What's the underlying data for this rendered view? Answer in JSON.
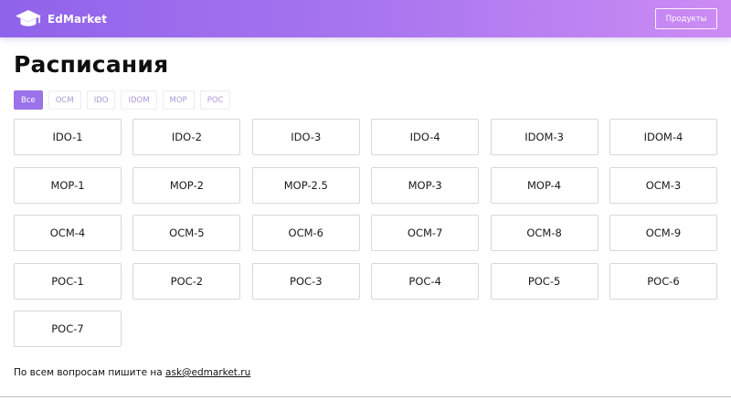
{
  "header": {
    "logo_text": "EdMarket",
    "products_button": "Продукты",
    "logo_icon": "graduation-cap-icon"
  },
  "main": {
    "title": "Расписания",
    "filters": [
      {
        "label": "Все",
        "active": true
      },
      {
        "label": "OCM",
        "active": false
      },
      {
        "label": "IDO",
        "active": false
      },
      {
        "label": "IDOM",
        "active": false
      },
      {
        "label": "MOP",
        "active": false
      },
      {
        "label": "POC",
        "active": false
      }
    ],
    "schedules": [
      "IDO-1",
      "IDO-2",
      "IDO-3",
      "IDO-4",
      "IDOM-3",
      "IDOM-4",
      "MOP-1",
      "MOP-2",
      "MOP-2.5",
      "MOP-3",
      "MOP-4",
      "OCM-3",
      "OCM-4",
      "OCM-5",
      "OCM-6",
      "OCM-7",
      "OCM-8",
      "OCM-9",
      "POC-1",
      "POC-2",
      "POC-3",
      "POC-4",
      "POC-5",
      "POC-6",
      "POC-7"
    ]
  },
  "footer": {
    "text": "По всем вопросам пишите на ",
    "email": "ask@edmarket.ru"
  },
  "colors": {
    "header_gradient_start": "#8f63ea",
    "header_gradient_end": "#cd8cf4",
    "accent": "#9b72ea",
    "filter_text": "#a99bd9"
  }
}
